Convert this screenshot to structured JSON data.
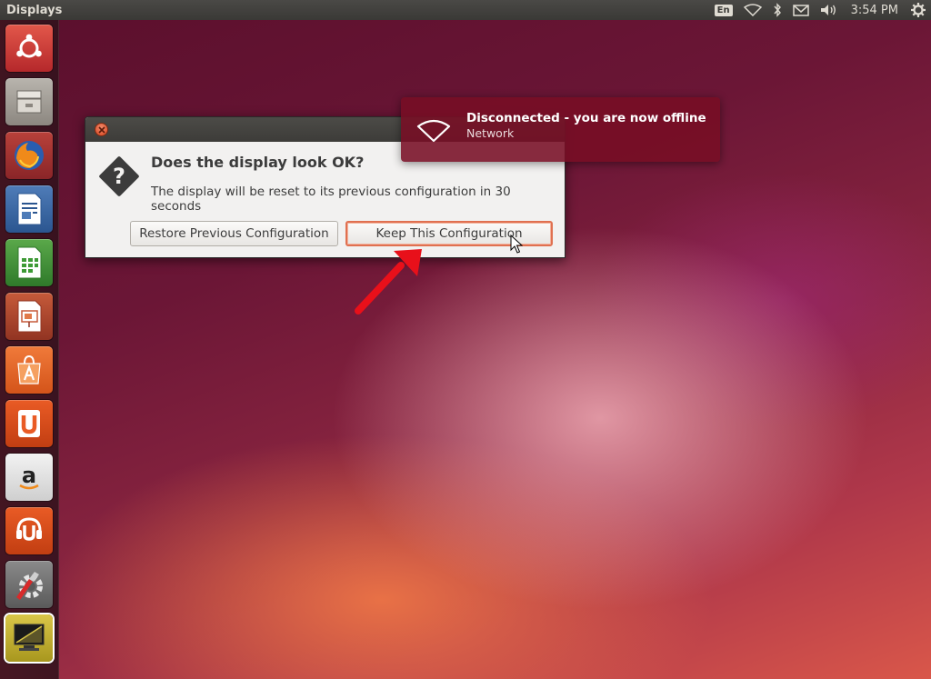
{
  "top_panel": {
    "app_title": "Displays",
    "keyboard_layout": "En",
    "clock": "3:54 PM",
    "indicators": [
      "network-icon",
      "bluetooth-icon",
      "mail-icon",
      "volume-icon",
      "gear-icon"
    ]
  },
  "launcher": {
    "items": [
      "ubuntu-logo-icon",
      "files-icon",
      "firefox-icon",
      "writer-icon",
      "calc-icon",
      "impress-icon",
      "software-center-icon",
      "ubuntu-one-icon",
      "amazon-icon",
      "ubuntu-one-music-icon",
      "system-settings-icon",
      "displays-icon"
    ]
  },
  "dialog": {
    "heading": "Does the display look OK?",
    "message": "The display will be reset to its previous configuration in 30 seconds",
    "restore_label": "Restore Previous Configuration",
    "keep_label": "Keep This Configuration"
  },
  "notification": {
    "title": "Disconnected - you are now offline",
    "body": "Network"
  },
  "colors": {
    "accent_orange": "#dd4814",
    "notification_bg": "#780e24",
    "arrow_red": "#e8101a"
  }
}
